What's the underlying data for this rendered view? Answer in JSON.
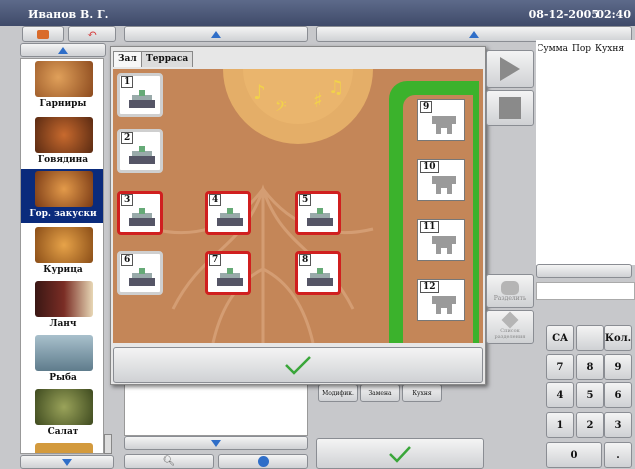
{
  "header": {
    "user": "Иванов В. Г.",
    "date": "08-12-2005",
    "time": "02:40"
  },
  "categories": [
    {
      "label": "Гарниры",
      "color": "#c9843f"
    },
    {
      "label": "Говядина",
      "color": "#a64b22"
    },
    {
      "label": "Гор. закуски",
      "color": "#b5733a",
      "selected": true
    },
    {
      "label": "Курица",
      "color": "#c98a3a"
    },
    {
      "label": "Ланч",
      "color": "#6e2f2a"
    },
    {
      "label": "Рыба",
      "color": "#6c8aa0"
    },
    {
      "label": "Салат",
      "color": "#6b7d3c"
    }
  ],
  "tabs": [
    "Зал",
    "Терраса"
  ],
  "hall_tables": [
    {
      "number": "1",
      "busy": false
    },
    {
      "number": "2",
      "busy": false
    },
    {
      "number": "3",
      "busy": true
    },
    {
      "number": "4",
      "busy": true
    },
    {
      "number": "5",
      "busy": true
    },
    {
      "number": "6",
      "busy": false
    },
    {
      "number": "7",
      "busy": true
    },
    {
      "number": "8",
      "busy": true
    }
  ],
  "terrace_tables": [
    "9",
    "10",
    "11",
    "12"
  ],
  "side_buttons": {
    "split": "Разделить",
    "split_list": "Список разделения"
  },
  "order_columns": [
    "Сумма",
    "Пор",
    "Кухня"
  ],
  "mini_buttons": [
    "Модифик.",
    "Замена",
    "Кухня"
  ],
  "numpad": {
    "ca": "CA",
    "qty": "Кол.",
    "keys": [
      "7",
      "8",
      "9",
      "4",
      "5",
      "6",
      "1",
      "2",
      "3",
      "0",
      "."
    ]
  },
  "colors": {
    "busy": "#d01f1f",
    "terrace": "#3bb22c",
    "floor": "#c48658",
    "selection": "#0a2b7c",
    "check": "#3aa63a"
  }
}
